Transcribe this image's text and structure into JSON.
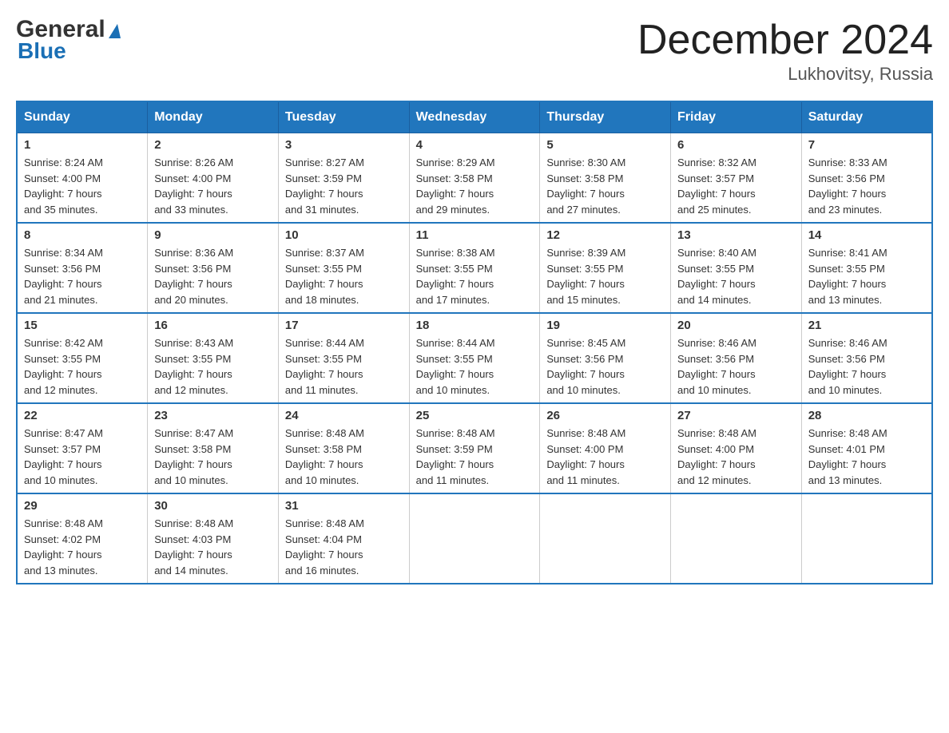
{
  "header": {
    "logo_line1": "General",
    "logo_line2": "Blue",
    "title": "December 2024",
    "subtitle": "Lukhovitsy, Russia"
  },
  "days_of_week": [
    "Sunday",
    "Monday",
    "Tuesday",
    "Wednesday",
    "Thursday",
    "Friday",
    "Saturday"
  ],
  "weeks": [
    [
      {
        "day": "1",
        "sunrise": "8:24 AM",
        "sunset": "4:00 PM",
        "daylight": "7 hours and 35 minutes."
      },
      {
        "day": "2",
        "sunrise": "8:26 AM",
        "sunset": "4:00 PM",
        "daylight": "7 hours and 33 minutes."
      },
      {
        "day": "3",
        "sunrise": "8:27 AM",
        "sunset": "3:59 PM",
        "daylight": "7 hours and 31 minutes."
      },
      {
        "day": "4",
        "sunrise": "8:29 AM",
        "sunset": "3:58 PM",
        "daylight": "7 hours and 29 minutes."
      },
      {
        "day": "5",
        "sunrise": "8:30 AM",
        "sunset": "3:58 PM",
        "daylight": "7 hours and 27 minutes."
      },
      {
        "day": "6",
        "sunrise": "8:32 AM",
        "sunset": "3:57 PM",
        "daylight": "7 hours and 25 minutes."
      },
      {
        "day": "7",
        "sunrise": "8:33 AM",
        "sunset": "3:56 PM",
        "daylight": "7 hours and 23 minutes."
      }
    ],
    [
      {
        "day": "8",
        "sunrise": "8:34 AM",
        "sunset": "3:56 PM",
        "daylight": "7 hours and 21 minutes."
      },
      {
        "day": "9",
        "sunrise": "8:36 AM",
        "sunset": "3:56 PM",
        "daylight": "7 hours and 20 minutes."
      },
      {
        "day": "10",
        "sunrise": "8:37 AM",
        "sunset": "3:55 PM",
        "daylight": "7 hours and 18 minutes."
      },
      {
        "day": "11",
        "sunrise": "8:38 AM",
        "sunset": "3:55 PM",
        "daylight": "7 hours and 17 minutes."
      },
      {
        "day": "12",
        "sunrise": "8:39 AM",
        "sunset": "3:55 PM",
        "daylight": "7 hours and 15 minutes."
      },
      {
        "day": "13",
        "sunrise": "8:40 AM",
        "sunset": "3:55 PM",
        "daylight": "7 hours and 14 minutes."
      },
      {
        "day": "14",
        "sunrise": "8:41 AM",
        "sunset": "3:55 PM",
        "daylight": "7 hours and 13 minutes."
      }
    ],
    [
      {
        "day": "15",
        "sunrise": "8:42 AM",
        "sunset": "3:55 PM",
        "daylight": "7 hours and 12 minutes."
      },
      {
        "day": "16",
        "sunrise": "8:43 AM",
        "sunset": "3:55 PM",
        "daylight": "7 hours and 12 minutes."
      },
      {
        "day": "17",
        "sunrise": "8:44 AM",
        "sunset": "3:55 PM",
        "daylight": "7 hours and 11 minutes."
      },
      {
        "day": "18",
        "sunrise": "8:44 AM",
        "sunset": "3:55 PM",
        "daylight": "7 hours and 10 minutes."
      },
      {
        "day": "19",
        "sunrise": "8:45 AM",
        "sunset": "3:56 PM",
        "daylight": "7 hours and 10 minutes."
      },
      {
        "day": "20",
        "sunrise": "8:46 AM",
        "sunset": "3:56 PM",
        "daylight": "7 hours and 10 minutes."
      },
      {
        "day": "21",
        "sunrise": "8:46 AM",
        "sunset": "3:56 PM",
        "daylight": "7 hours and 10 minutes."
      }
    ],
    [
      {
        "day": "22",
        "sunrise": "8:47 AM",
        "sunset": "3:57 PM",
        "daylight": "7 hours and 10 minutes."
      },
      {
        "day": "23",
        "sunrise": "8:47 AM",
        "sunset": "3:58 PM",
        "daylight": "7 hours and 10 minutes."
      },
      {
        "day": "24",
        "sunrise": "8:48 AM",
        "sunset": "3:58 PM",
        "daylight": "7 hours and 10 minutes."
      },
      {
        "day": "25",
        "sunrise": "8:48 AM",
        "sunset": "3:59 PM",
        "daylight": "7 hours and 11 minutes."
      },
      {
        "day": "26",
        "sunrise": "8:48 AM",
        "sunset": "4:00 PM",
        "daylight": "7 hours and 11 minutes."
      },
      {
        "day": "27",
        "sunrise": "8:48 AM",
        "sunset": "4:00 PM",
        "daylight": "7 hours and 12 minutes."
      },
      {
        "day": "28",
        "sunrise": "8:48 AM",
        "sunset": "4:01 PM",
        "daylight": "7 hours and 13 minutes."
      }
    ],
    [
      {
        "day": "29",
        "sunrise": "8:48 AM",
        "sunset": "4:02 PM",
        "daylight": "7 hours and 13 minutes."
      },
      {
        "day": "30",
        "sunrise": "8:48 AM",
        "sunset": "4:03 PM",
        "daylight": "7 hours and 14 minutes."
      },
      {
        "day": "31",
        "sunrise": "8:48 AM",
        "sunset": "4:04 PM",
        "daylight": "7 hours and 16 minutes."
      },
      null,
      null,
      null,
      null
    ]
  ],
  "labels": {
    "sunrise": "Sunrise:",
    "sunset": "Sunset:",
    "daylight": "Daylight:"
  }
}
